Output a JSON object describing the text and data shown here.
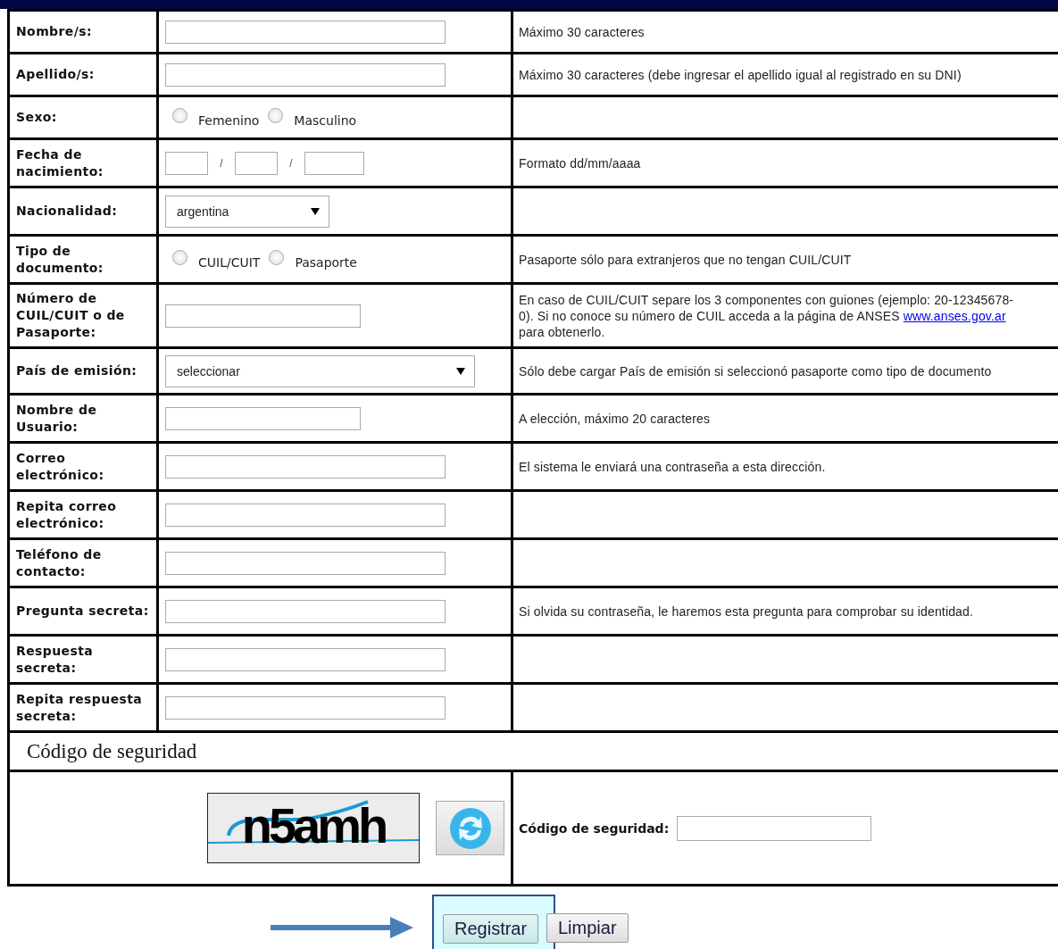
{
  "rows": [
    {
      "label": "Nombre/s:",
      "kind": "text",
      "help": "Máximo 30 caracteres"
    },
    {
      "label": "Apellido/s:",
      "kind": "text",
      "help": "Máximo 30 caracteres (debe ingresar el apellido igual al registrado en su DNI)"
    },
    {
      "label": "Sexo:",
      "kind": "radio",
      "options": [
        {
          "label": "Femenino",
          "selected": false
        },
        {
          "label": "Masculino",
          "selected": false
        }
      ]
    },
    {
      "label": "Fecha de nacimiento:",
      "kind": "date",
      "separators": [
        "/",
        "/"
      ],
      "help": "Formato dd/mm/aaaa"
    },
    {
      "label": "Nacionalidad:",
      "kind": "select",
      "value": "argentina"
    },
    {
      "label": "Tipo de documento:",
      "kind": "radio",
      "options": [
        {
          "label": "CUIL/CUIT",
          "selected": false
        },
        {
          "label": "Pasaporte",
          "selected": false
        }
      ],
      "help": "Pasaporte sólo para extranjeros que no tengan CUIL/CUIT"
    },
    {
      "label": "Número de CUIL/CUIT o de Pasaporte:",
      "kind": "short-text",
      "help": "En caso de CUIL/CUIT separe los 3 componentes con guiones (ejemplo: 20-12345678-0). Si no conoce su número de CUIL acceda a la página de ANSES",
      "help_link": "www.anses.gov.ar",
      "help_after": "para obtenerlo."
    },
    {
      "label": "País de emisión:",
      "kind": "wide-select",
      "value": "seleccionar",
      "help": "Sólo debe cargar País de emisión si seleccionó pasaporte como tipo de documento"
    },
    {
      "label": "Nombre de Usuario:",
      "kind": "short-text",
      "help": "A elección, máximo 20 caracteres"
    },
    {
      "label": "Correo electrónico:",
      "kind": "text",
      "help": "El sistema le enviará una contraseña a esta dirección."
    },
    {
      "label": "Repita correo electrónico:",
      "kind": "text"
    },
    {
      "label": "Teléfono de contacto:",
      "kind": "text"
    },
    {
      "label": "Pregunta secreta:",
      "kind": "text",
      "help": "Si olvida su contraseña, le haremos esta pregunta para comprobar su identidad."
    },
    {
      "label": "Respuesta secreta:",
      "kind": "text"
    },
    {
      "label": "Repita respuesta secreta:",
      "kind": "text"
    }
  ],
  "security": {
    "heading": "Código de seguridad",
    "captcha_text": "n5amh",
    "field_label": "Código de seguridad:"
  },
  "buttons": [
    {
      "label": "Registrar",
      "highlighted": true
    },
    {
      "label": "Limpiar",
      "highlighted": false
    }
  ]
}
